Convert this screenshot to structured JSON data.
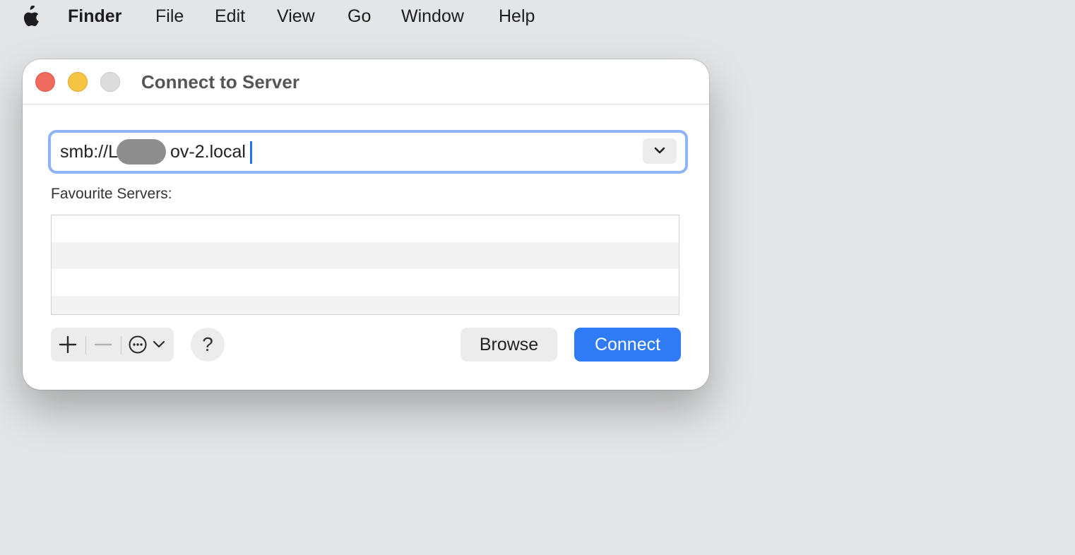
{
  "menubar": {
    "apple_icon": "apple-icon",
    "app_name": "Finder",
    "items": [
      "File",
      "Edit",
      "View",
      "Go",
      "Window",
      "Help"
    ]
  },
  "window": {
    "title": "Connect to Server",
    "server_address": {
      "value_prefix": "smb://L",
      "value_suffix": "ov-2.local",
      "redacted": true
    },
    "favourites_label": "Favourite Servers:",
    "favourites": [],
    "controls": {
      "add_icon": "plus-icon",
      "remove_icon": "minus-icon",
      "more_icon": "ellipsis-circle-icon",
      "more_chevron_icon": "chevron-down-icon",
      "help_label": "?",
      "browse_label": "Browse",
      "connect_label": "Connect"
    }
  },
  "colors": {
    "accent": "#2f7bf5",
    "focus_ring": "#8fb4f5",
    "close": "#ee6a5f",
    "minimize": "#f5c443",
    "zoom_disabled": "#dcdcdc"
  }
}
